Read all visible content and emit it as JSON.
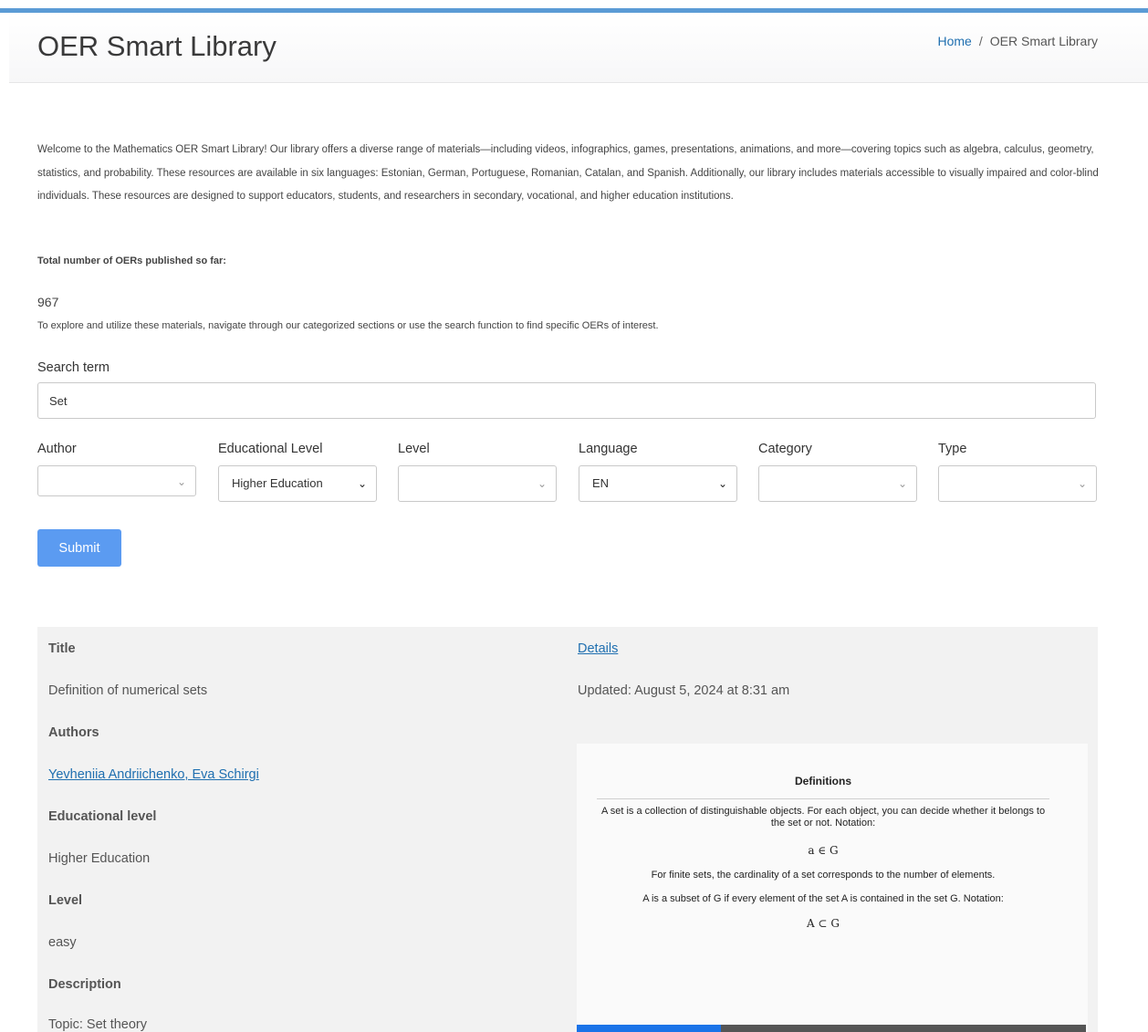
{
  "header": {
    "title": "OER Smart Library",
    "breadcrumb": {
      "home": "Home",
      "separator": "/",
      "current": "OER Smart Library"
    }
  },
  "intro": {
    "welcome": "Welcome to the Mathematics OER Smart Library! Our library offers a diverse range of materials—including videos, infographics, games, presentations, animations, and more—covering topics such as algebra, calculus, geometry, statistics, and probability. These resources are available in six languages: Estonian, German, Portuguese, Romanian, Catalan, and Spanish. Additionally, our library includes materials accessible to visually impaired and color-blind individuals. These resources are designed to support educators, students, and researchers in secondary, vocational, and higher education institutions.",
    "total_label": "Total number of OERs published so far:",
    "total_value": "967",
    "explore": "To explore and utilize these materials, navigate through our categorized sections or use the search function to find specific OERs of interest."
  },
  "search": {
    "label": "Search term",
    "value": "Set",
    "placeholder": ""
  },
  "filters": [
    {
      "label": "Author",
      "value": ""
    },
    {
      "label": "Educational Level",
      "value": "Higher Education"
    },
    {
      "label": "Level",
      "value": ""
    },
    {
      "label": "Language",
      "value": "EN"
    },
    {
      "label": "Category",
      "value": ""
    },
    {
      "label": "Type",
      "value": ""
    }
  ],
  "submit_label": "Submit",
  "result": {
    "title_label": "Title",
    "title": "Definition of numerical sets",
    "authors_label": "Authors",
    "authors": "Yevheniia Andriichenko, Eva Schirgi",
    "edu_level_label": "Educational level",
    "edu_level": "Higher Education",
    "level_label": "Level",
    "level": "easy",
    "description_label": "Description",
    "description": "Topic: Set theory",
    "details_link": "Details",
    "updated": "Updated: August 5, 2024 at 8:31 am",
    "preview": {
      "heading": "Definitions",
      "line1": "A set is a collection of distinguishable objects.  For each object, you can decide whether it belongs to the set or not. Notation:",
      "math1": "a ∈ G",
      "line2": "For finite sets, the cardinality of a set corresponds to the number of elements.",
      "line3": "A is a subset of G if every element of the set A is contained in the set G. Notation:",
      "math2": "A ⊂ G"
    }
  },
  "colors": {
    "accent": "#5b9bd5",
    "button": "#5b9bf1",
    "link": "#1f6fb0",
    "preview_bar_blue": "#1a73e8",
    "preview_bar_gray": "#555555"
  },
  "icons": {
    "select_chevron": "chevron-down-icon"
  }
}
